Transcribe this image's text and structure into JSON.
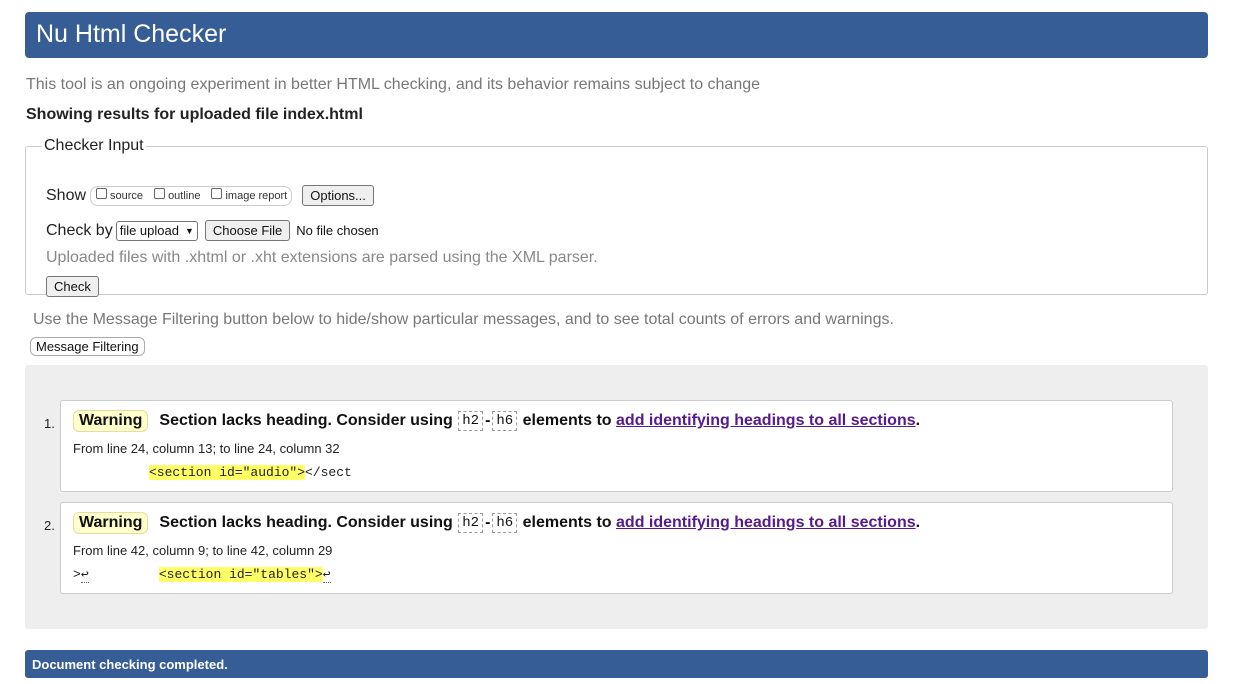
{
  "header": {
    "title": "Nu Html Checker"
  },
  "intro": "This tool is an ongoing experiment in better HTML checking, and its behavior remains subject to change",
  "results_for": "Showing results for uploaded file index.html",
  "checker_input": {
    "legend": "Checker Input",
    "show_label": "Show",
    "show_options": [
      {
        "label": "source",
        "checked": false
      },
      {
        "label": "outline",
        "checked": false
      },
      {
        "label": "image report",
        "checked": false
      }
    ],
    "options_button": "Options...",
    "check_by_label": "Check by",
    "check_by_value": "file upload",
    "choose_file_button": "Choose File",
    "no_file_text": "No file chosen",
    "xml_note": "Uploaded files with .xhtml or .xht extensions are parsed using the XML parser.",
    "check_button": "Check"
  },
  "filter_note": "Use the Message Filtering button below to hide/show particular messages, and to see total counts of errors and warnings.",
  "filter_button": "Message Filtering",
  "messages": [
    {
      "number": "1.",
      "type": "Warning",
      "text_before": "Section lacks heading. Consider using ",
      "code_a": "h2",
      "dash": "-",
      "code_b": "h6",
      "text_middle": " elements to ",
      "link_text": "add identifying headings to all sections",
      "text_after": ".",
      "location": "From line 24, column 13; to line 24, column 32",
      "extract_pre": "",
      "extract_highlight": "<section id=\"audio\">",
      "extract_post": "</sect"
    },
    {
      "number": "2.",
      "type": "Warning",
      "text_before": "Section lacks heading. Consider using ",
      "code_a": "h2",
      "dash": "-",
      "code_b": "h6",
      "text_middle": " elements to ",
      "link_text": "add identifying headings to all sections",
      "text_after": ".",
      "location": "From line 42, column 9; to line 42, column 29",
      "extract_pre": ">",
      "extract_lf1": "↩",
      "extract_gap": "         ",
      "extract_highlight": "<section id=\"tables\">",
      "extract_lf2": "↩"
    }
  ],
  "footer": "Document checking completed."
}
